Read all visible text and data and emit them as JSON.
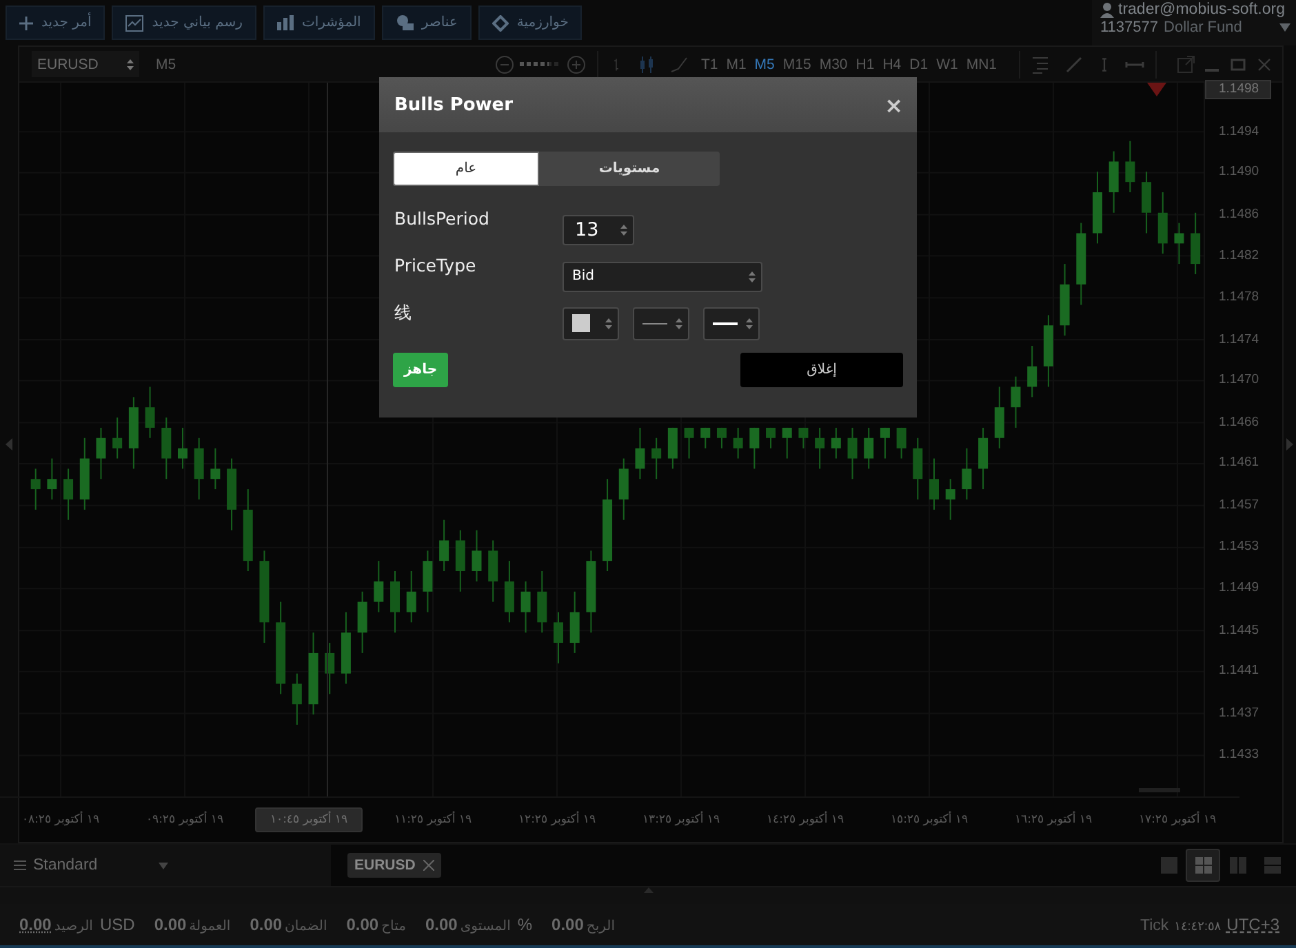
{
  "top_bar": {
    "buttons": [
      {
        "kind": "algorithm",
        "label": "خوارزمية"
      },
      {
        "kind": "objects",
        "label": "عناصر"
      },
      {
        "kind": "indicators",
        "label": "المؤشرات"
      },
      {
        "kind": "new-chart",
        "label": "رسم بياني جديد"
      },
      {
        "kind": "new-order",
        "label": "أمر جديد"
      }
    ],
    "account": {
      "user": "trader@mobius-soft.org",
      "number": "1137577",
      "name": "Dollar Fund"
    }
  },
  "chart": {
    "symbol": "EURUSD",
    "timeframe": "M5",
    "zoom": {
      "level": 0.67
    },
    "timeframes": [
      {
        "label": "MN1",
        "selected": false
      },
      {
        "label": "W1",
        "selected": false
      },
      {
        "label": "D1",
        "selected": false
      },
      {
        "label": "H4",
        "selected": false
      },
      {
        "label": "H1",
        "selected": false
      },
      {
        "label": "M30",
        "selected": false
      },
      {
        "label": "M15",
        "selected": false
      },
      {
        "label": "M5",
        "selected": true
      },
      {
        "label": "M1",
        "selected": false
      },
      {
        "label": "T1",
        "selected": false
      }
    ],
    "current_price": "1.1498",
    "chart_data": {
      "type": "candlestick",
      "categories": [
        null,
        null,
        null,
        null,
        null,
        null,
        null,
        null,
        null,
        null,
        null,
        null,
        null,
        null,
        null,
        null,
        null,
        null,
        null,
        null,
        null,
        null,
        null,
        null,
        null,
        null,
        null,
        null,
        null,
        null,
        null,
        null,
        null,
        null,
        null,
        null,
        null,
        null,
        null,
        null,
        null,
        null,
        null,
        null,
        null,
        null,
        null,
        null,
        null,
        null,
        null,
        null,
        null,
        null,
        null,
        null,
        null,
        null,
        null,
        null,
        null,
        null,
        null,
        null,
        null,
        null,
        null,
        null,
        null,
        null,
        null,
        null
      ],
      "ohlc": [
        [
          1.146,
          1.1461,
          1.1457,
          1.1459
        ],
        [
          1.1459,
          1.1462,
          1.1458,
          1.146
        ],
        [
          1.146,
          1.1461,
          1.1456,
          1.1458
        ],
        [
          1.1458,
          1.1464,
          1.1457,
          1.1462
        ],
        [
          1.1462,
          1.1465,
          1.146,
          1.1464
        ],
        [
          1.1464,
          1.1466,
          1.1462,
          1.1463
        ],
        [
          1.1463,
          1.1468,
          1.1461,
          1.1467
        ],
        [
          1.1467,
          1.1469,
          1.1464,
          1.1465
        ],
        [
          1.1465,
          1.1466,
          1.146,
          1.1462
        ],
        [
          1.1462,
          1.1465,
          1.1461,
          1.1463
        ],
        [
          1.1463,
          1.1464,
          1.1458,
          1.146
        ],
        [
          1.146,
          1.1463,
          1.1459,
          1.1461
        ],
        [
          1.1461,
          1.1462,
          1.1455,
          1.1457
        ],
        [
          1.1457,
          1.1459,
          1.1451,
          1.1452
        ],
        [
          1.1452,
          1.1453,
          1.1444,
          1.1446
        ],
        [
          1.1446,
          1.1448,
          1.1439,
          1.144
        ],
        [
          1.144,
          1.1441,
          1.1436,
          1.1438
        ],
        [
          1.1438,
          1.1445,
          1.1437,
          1.1443
        ],
        [
          1.1443,
          1.1444,
          1.1439,
          1.1441
        ],
        [
          1.1441,
          1.1447,
          1.144,
          1.1445
        ],
        [
          1.1445,
          1.1449,
          1.1443,
          1.1448
        ],
        [
          1.1448,
          1.1452,
          1.1447,
          1.145
        ],
        [
          1.145,
          1.1451,
          1.1445,
          1.1447
        ],
        [
          1.1447,
          1.1451,
          1.1446,
          1.1449
        ],
        [
          1.1449,
          1.1453,
          1.1447,
          1.1452
        ],
        [
          1.1452,
          1.1456,
          1.1451,
          1.1454
        ],
        [
          1.1454,
          1.1455,
          1.1449,
          1.1451
        ],
        [
          1.1451,
          1.1455,
          1.145,
          1.1453
        ],
        [
          1.1453,
          1.1454,
          1.1448,
          1.145
        ],
        [
          1.145,
          1.1452,
          1.1446,
          1.1447
        ],
        [
          1.1447,
          1.145,
          1.1445,
          1.1449
        ],
        [
          1.1449,
          1.1451,
          1.1445,
          1.1446
        ],
        [
          1.1446,
          1.1447,
          1.1442,
          1.1444
        ],
        [
          1.1444,
          1.1449,
          1.1443,
          1.1447
        ],
        [
          1.1447,
          1.1453,
          1.1445,
          1.1452
        ],
        [
          1.1452,
          1.146,
          1.1451,
          1.1458
        ],
        [
          1.1458,
          1.1462,
          1.1456,
          1.1461
        ],
        [
          1.1461,
          1.1465,
          1.146,
          1.1463
        ],
        [
          1.1463,
          1.1464,
          1.146,
          1.1462
        ],
        [
          1.1462,
          1.1465,
          1.1461,
          1.1465
        ],
        [
          1.1465,
          1.1465,
          1.1462,
          1.1464
        ],
        [
          1.1464,
          1.1465,
          1.1463,
          1.1465
        ],
        [
          1.1465,
          1.1465,
          1.1463,
          1.1464
        ],
        [
          1.1464,
          1.1465,
          1.1462,
          1.1463
        ],
        [
          1.1463,
          1.1465,
          1.1461,
          1.1465
        ],
        [
          1.1465,
          1.1465,
          1.1463,
          1.1464
        ],
        [
          1.1464,
          1.1465,
          1.1462,
          1.1465
        ],
        [
          1.1465,
          1.1465,
          1.1463,
          1.1464
        ],
        [
          1.1464,
          1.1465,
          1.1461,
          1.1463
        ],
        [
          1.1463,
          1.1465,
          1.1462,
          1.1464
        ],
        [
          1.1464,
          1.1465,
          1.146,
          1.1462
        ],
        [
          1.1462,
          1.1465,
          1.1461,
          1.1464
        ],
        [
          1.1464,
          1.1465,
          1.1462,
          1.1465
        ],
        [
          1.1465,
          1.1465,
          1.1462,
          1.1463
        ],
        [
          1.1463,
          1.1464,
          1.1458,
          1.146
        ],
        [
          1.146,
          1.1462,
          1.1457,
          1.1458
        ],
        [
          1.1458,
          1.146,
          1.1456,
          1.1459
        ],
        [
          1.1459,
          1.1463,
          1.1458,
          1.1461
        ],
        [
          1.1461,
          1.1465,
          1.1459,
          1.1464
        ],
        [
          1.1464,
          1.1469,
          1.1463,
          1.1467
        ],
        [
          1.1467,
          1.147,
          1.1465,
          1.1469
        ],
        [
          1.1469,
          1.1473,
          1.1468,
          1.1471
        ],
        [
          1.1471,
          1.1476,
          1.1469,
          1.1475
        ],
        [
          1.1475,
          1.1481,
          1.1474,
          1.1479
        ],
        [
          1.1479,
          1.1485,
          1.1477,
          1.1484
        ],
        [
          1.1484,
          1.149,
          1.1483,
          1.1488
        ],
        [
          1.1488,
          1.1492,
          1.1486,
          1.1491
        ],
        [
          1.1491,
          1.1493,
          1.1488,
          1.1489
        ],
        [
          1.1489,
          1.149,
          1.1484,
          1.1486
        ],
        [
          1.1486,
          1.1488,
          1.1482,
          1.1483
        ],
        [
          1.1483,
          1.1485,
          1.1481,
          1.1484
        ],
        [
          1.1484,
          1.1486,
          1.148,
          1.1481
        ]
      ],
      "ylim": [
        1.1429,
        1.14987
      ],
      "grid": true,
      "yticks": [
        {
          "value": 1.14939,
          "label": "1.1494"
        },
        {
          "value": 1.14899,
          "label": "1.1490"
        },
        {
          "value": 1.14858,
          "label": "1.1486"
        },
        {
          "value": 1.14818,
          "label": "1.1482"
        },
        {
          "value": 1.14777,
          "label": "1.1478"
        },
        {
          "value": 1.14736,
          "label": "1.1474"
        },
        {
          "value": 1.14696,
          "label": "1.1470"
        },
        {
          "value": 1.14655,
          "label": "1.1466"
        },
        {
          "value": 1.14615,
          "label": "1.1461"
        },
        {
          "value": 1.14574,
          "label": "1.1457"
        },
        {
          "value": 1.14533,
          "label": "1.1453"
        },
        {
          "value": 1.14493,
          "label": "1.1449"
        },
        {
          "value": 1.14452,
          "label": "1.1445"
        },
        {
          "value": 1.14412,
          "label": "1.1441"
        },
        {
          "value": 1.14371,
          "label": "1.1437"
        },
        {
          "value": 1.1433,
          "label": "1.1433"
        }
      ]
    },
    "time_labels": [
      {
        "text": "١٩ أكتوبر ١٧:٢٥",
        "highlighted": false
      },
      {
        "text": "١٩ أكتوبر ١٦:٢٥",
        "highlighted": false
      },
      {
        "text": "١٩ أكتوبر ١٥:٢٥",
        "highlighted": false
      },
      {
        "text": "١٩ أكتوبر ١٤:٢٥",
        "highlighted": false
      },
      {
        "text": "١٩ أكتوبر ١٣:٢٥",
        "highlighted": false
      },
      {
        "text": "١٩ أكتوبر ١٢:٢٥",
        "highlighted": false
      },
      {
        "text": "١٩ أكتوبر ١١:٢٥",
        "highlighted": false
      },
      {
        "text": "١٩ أكتوبر ١٠:٤٥",
        "highlighted": true
      },
      {
        "text": "١٩ أكتوبر ٠٩:٢٥",
        "highlighted": false
      },
      {
        "text": "١٩ أكتوبر ٠٨:٢٥",
        "highlighted": false
      }
    ]
  },
  "bottom_bar": {
    "profile": "Standard",
    "tabs": [
      {
        "label": "EURUSD"
      }
    ],
    "layouts": [
      {
        "kind": "rows",
        "selected": false
      },
      {
        "kind": "columns",
        "selected": false
      },
      {
        "kind": "grid",
        "selected": true
      },
      {
        "kind": "single",
        "selected": false
      }
    ]
  },
  "status_bar": {
    "stats": [
      {
        "value": "0.00",
        "label": "الربح"
      },
      {
        "value": "0.00",
        "label": "المستوى",
        "unit": "%"
      },
      {
        "value": "0.00",
        "label": "متاح"
      },
      {
        "value": "0.00",
        "label": "الضمان"
      },
      {
        "value": "0.00",
        "label": "العمولة"
      },
      {
        "value": "0.00",
        "label": "الرصيد",
        "unit": "USD"
      }
    ],
    "tick_label": "Tick",
    "tick_time": "١٤:٤٢:٥٨",
    "timezone": "UTC+3"
  },
  "dialog": {
    "title": "Bulls Power",
    "close": "×",
    "tabs": [
      {
        "label": "مستويات",
        "selected": false
      },
      {
        "label": "عام",
        "selected": true
      }
    ],
    "params": [
      {
        "kind": "number",
        "label": "BullsPeriod",
        "value": "13"
      },
      {
        "kind": "select",
        "label": "PriceType",
        "value": "Bid"
      },
      {
        "kind": "line",
        "label": "线",
        "color": "#cccccc"
      }
    ],
    "buttons": [
      {
        "kind": "secondary",
        "label": "إغلاق"
      },
      {
        "kind": "primary",
        "label": "جاهز"
      }
    ]
  }
}
